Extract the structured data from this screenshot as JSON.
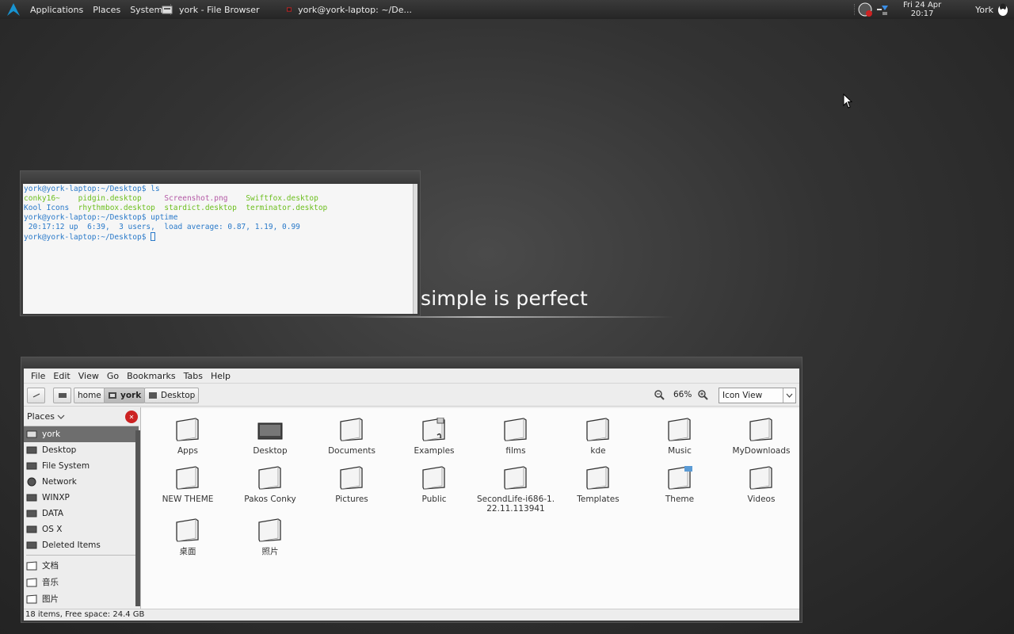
{
  "panel": {
    "menus": [
      "Applications",
      "Places",
      "System"
    ],
    "tasks": [
      {
        "label": "york - File Browser",
        "icon": "file-browser-icon"
      },
      {
        "label": "york@york-laptop: ~/De...",
        "icon": "terminal-icon"
      }
    ],
    "clock": {
      "date": "Fri 24 Apr",
      "time": "20:17"
    },
    "user": "York"
  },
  "terminal": {
    "prompt1": "york@york-laptop:~/Desktop$ ls",
    "ls_row1": {
      "c1": "conky16~",
      "c2": "pidgin.desktop",
      "c3": "Screenshot.png",
      "c4": "Swiftfox.desktop"
    },
    "ls_row2": {
      "c1": "Kool Icons",
      "c2": "rhythmbox.desktop",
      "c3": "stardict.desktop",
      "c4": "terminator.desktop"
    },
    "prompt2": "york@york-laptop:~/Desktop$ uptime",
    "uptime": " 20:17:12 up  6:39,  3 users,  load average: 0.87, 1.19, 0.99",
    "prompt3": "york@york-laptop:~/Desktop$ "
  },
  "tagline": "simple is perfect",
  "filebrowser": {
    "menu": [
      "File",
      "Edit",
      "View",
      "Go",
      "Bookmarks",
      "Tabs",
      "Help"
    ],
    "path": [
      "home",
      "york",
      "Desktop"
    ],
    "zoom": "66%",
    "view_mode": "Icon View",
    "places_label": "Places",
    "places": [
      "york",
      "Desktop",
      "File System",
      "Network",
      "WINXP",
      "DATA",
      "OS X",
      "Deleted Items"
    ],
    "bookmarks": [
      "文档",
      "音乐",
      "图片"
    ],
    "items": [
      "Apps",
      "Desktop",
      "Documents",
      "Examples",
      "films",
      "kde",
      "Music",
      "MyDownloads",
      "NEW THEME",
      "Pakos Conky",
      "Pictures",
      "Public",
      "SecondLife-i686-1.\n22.11.113941",
      "Templates",
      "Theme",
      "Videos",
      "桌面",
      "照片"
    ],
    "status": "18 items, Free space: 24.4 GB"
  },
  "colors": {
    "accent_blue": "#2979c9",
    "terminal_green": "#6cbf1e",
    "terminal_pink": "#b45aa5"
  }
}
